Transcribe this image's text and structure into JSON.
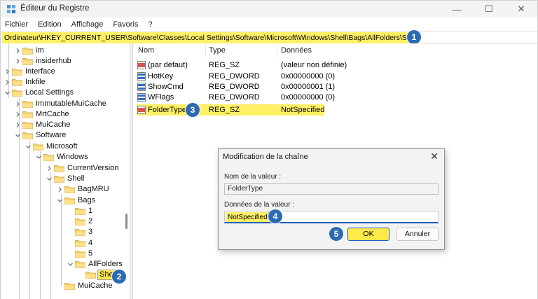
{
  "window": {
    "title": "Éditeur du Registre",
    "minimize_glyph": "—",
    "maximize_glyph": "☐",
    "close_glyph": "✕"
  },
  "menu": [
    "Fichier",
    "Edition",
    "Affichage",
    "Favoris",
    "?"
  ],
  "address": {
    "path": "Ordinateur\\HKEY_CURRENT_USER\\Software\\Classes\\Local Settings\\Software\\Microsoft\\Windows\\Shell\\Bags\\AllFolders\\Shell"
  },
  "steps": [
    "1",
    "2",
    "3",
    "4",
    "5"
  ],
  "tree": {
    "items": [
      {
        "label": "im",
        "expanded": false
      },
      {
        "label": "insiderhub",
        "expanded": false
      },
      {
        "label": "Interface",
        "expanded": false
      },
      {
        "label": "Inkfile",
        "expanded": false
      },
      {
        "label": "Local Settings",
        "expanded": true
      },
      {
        "label": "ImmutableMuiCache",
        "expanded": false
      },
      {
        "label": "MrtCache",
        "expanded": false
      },
      {
        "label": "MuiCache",
        "expanded": false
      },
      {
        "label": "Software",
        "expanded": true
      },
      {
        "label": "Microsoft",
        "expanded": true
      },
      {
        "label": "Windows",
        "expanded": true
      },
      {
        "label": "CurrentVersion",
        "expanded": false
      },
      {
        "label": "Shell",
        "expanded": true
      },
      {
        "label": "BagMRU",
        "expanded": false
      },
      {
        "label": "Bags",
        "expanded": true
      },
      {
        "label": "1",
        "expanded": false
      },
      {
        "label": "2",
        "expanded": false
      },
      {
        "label": "3",
        "expanded": false
      },
      {
        "label": "4",
        "expanded": false
      },
      {
        "label": "5",
        "expanded": false
      },
      {
        "label": "AllFolders",
        "expanded": true
      },
      {
        "label": "Shell",
        "expanded": false,
        "selected": true
      },
      {
        "label": "MuiCache",
        "expanded": false
      }
    ]
  },
  "list": {
    "headers": {
      "name": "Nom",
      "type": "Type",
      "data": "Données"
    },
    "rows": [
      {
        "name": "(par défaut)",
        "type": "REG_SZ",
        "data": "(valeur non définie)",
        "icon": "string-value-icon"
      },
      {
        "name": "HotKey",
        "type": "REG_DWORD",
        "data": "0x00000000 (0)",
        "icon": "dword-value-icon"
      },
      {
        "name": "ShowCmd",
        "type": "REG_DWORD",
        "data": "0x00000001 (1)",
        "icon": "dword-value-icon"
      },
      {
        "name": "WFlags",
        "type": "REG_DWORD",
        "data": "0x00000000 (0)",
        "icon": "dword-value-icon"
      },
      {
        "name": "FolderType",
        "type": "REG_SZ",
        "data": "NotSpecified",
        "icon": "string-value-icon",
        "highlighted": true
      }
    ]
  },
  "dialog": {
    "title": "Modification de la chaîne",
    "close_glyph": "✕",
    "value_name_label": "Nom de la valeur :",
    "value_name": "FolderType",
    "value_data_label": "Données de la valeur :",
    "value_data": "NotSpecified",
    "ok_label": "OK",
    "cancel_label": "Annuler"
  },
  "colors": {
    "highlight": "#fff066",
    "badge": "#2c6bb3",
    "accent": "#1f5fbf",
    "folder": "#f7d26a"
  }
}
